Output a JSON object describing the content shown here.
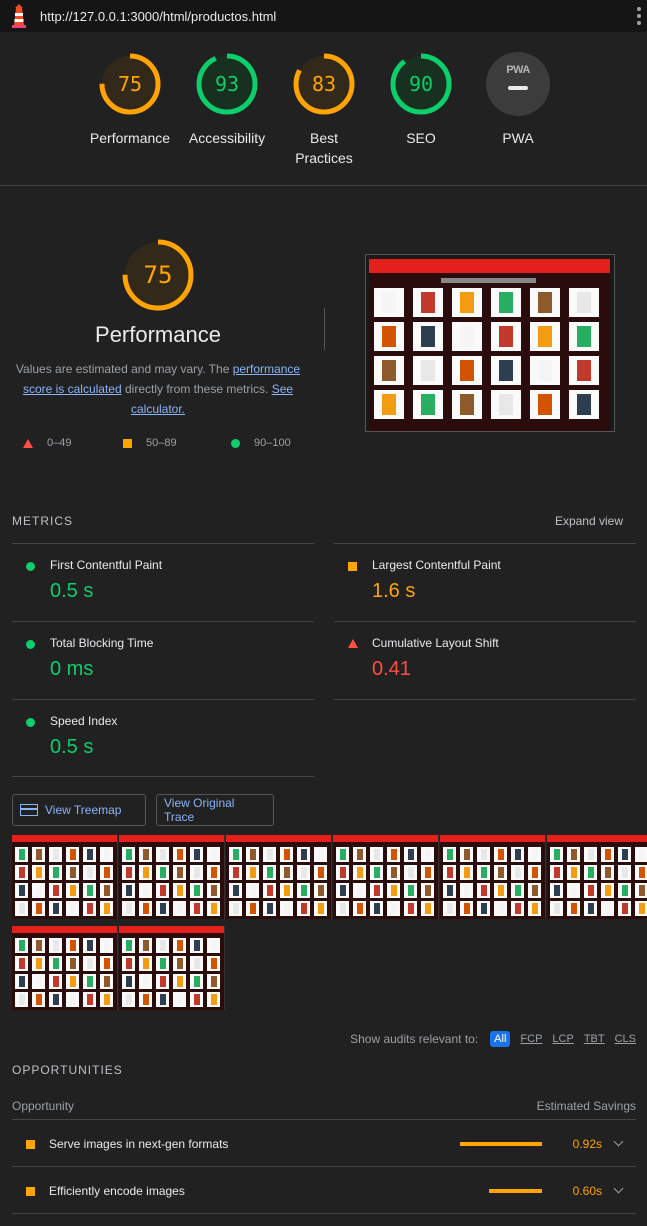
{
  "topbar": {
    "url": "http://127.0.0.1:3000/html/productos.html",
    "logo_icon": "lighthouse-icon",
    "menu_icon": "kebab-menu-icon"
  },
  "scores": [
    {
      "label": "Performance",
      "value": "75",
      "color": "#ffa400"
    },
    {
      "label": "Accessibility",
      "value": "93",
      "color": "#0cce6b"
    },
    {
      "label": "Best Practices",
      "value": "83",
      "color": "#ffa400"
    },
    {
      "label": "SEO",
      "value": "90",
      "color": "#0cce6b"
    },
    {
      "label": "PWA",
      "value": "",
      "color": "#9aa0a6"
    }
  ],
  "pwa_badge": "PWA",
  "performance": {
    "score": "75",
    "title": "Performance",
    "desc_1": "Values are estimated and may vary. The ",
    "desc_link_1": "performance score is calculated",
    "desc_2": " directly from these metrics. ",
    "desc_link_2": "See calculator.",
    "legend": {
      "fail": "0–49",
      "average": "50–89",
      "pass": "90–100"
    }
  },
  "metrics": {
    "heading": "METRICS",
    "expand": "Expand view",
    "items": [
      {
        "name": "First Contentful Paint",
        "value": "0.5 s",
        "status": "pass"
      },
      {
        "name": "Largest Contentful Paint",
        "value": "1.6 s",
        "status": "average"
      },
      {
        "name": "Total Blocking Time",
        "value": "0 ms",
        "status": "pass"
      },
      {
        "name": "Cumulative Layout Shift",
        "value": "0.41",
        "status": "fail"
      },
      {
        "name": "Speed Index",
        "value": "0.5 s",
        "status": "pass"
      }
    ]
  },
  "buttons": {
    "treemap": "View Treemap",
    "trace": "View Original Trace"
  },
  "filters": {
    "label": "Show audits relevant to:",
    "chips": [
      "All",
      "FCP",
      "LCP",
      "TBT",
      "CLS"
    ],
    "active": "All"
  },
  "opportunities": {
    "heading": "OPPORTUNITIES",
    "col_left": "Opportunity",
    "col_right": "Estimated Savings",
    "items": [
      {
        "title": "Serve images in next-gen formats",
        "savings": "0.92s",
        "savings_fraction": 1.0
      },
      {
        "title": "Efficiently encode images",
        "savings": "0.60s",
        "savings_fraction": 0.65
      }
    ]
  },
  "colors": {
    "pass": "#0cce6b",
    "average": "#ffa400",
    "fail": "#ff4e42",
    "link": "#8ab4f8",
    "background": "#212121"
  }
}
